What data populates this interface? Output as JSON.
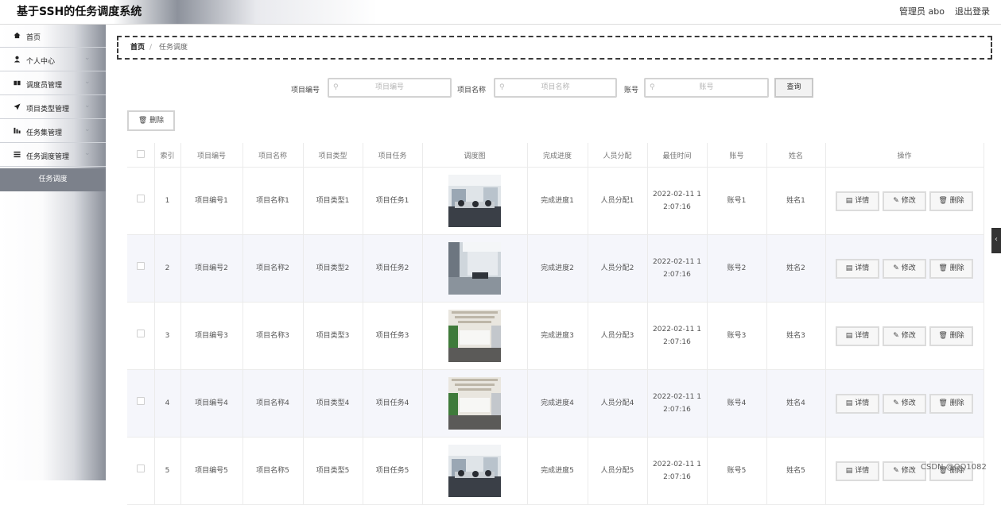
{
  "header": {
    "app_title": "基于SSH的任务调度系统",
    "user": "管理员 abo",
    "logout": "退出登录"
  },
  "sidebar": {
    "items": [
      {
        "label": "首页",
        "icon": "home-icon"
      },
      {
        "label": "个人中心",
        "icon": "user-icon"
      },
      {
        "label": "调度员管理",
        "icon": "users-icon"
      },
      {
        "label": "项目类型管理",
        "icon": "send-icon"
      },
      {
        "label": "任务集管理",
        "icon": "chart-icon"
      },
      {
        "label": "任务调度管理",
        "icon": "list-icon"
      }
    ],
    "active_sub": "任务调度"
  },
  "breadcrumb": {
    "home": "首页",
    "separator": "/",
    "current": "任务调度"
  },
  "search": {
    "fields": [
      {
        "label": "项目编号",
        "placeholder": "项目编号"
      },
      {
        "label": "项目名称",
        "placeholder": "项目名称"
      },
      {
        "label": "账号",
        "placeholder": "账号"
      }
    ],
    "button": "查询"
  },
  "toolbar": {
    "delete_label": "删除"
  },
  "table": {
    "headers": [
      "索引",
      "项目编号",
      "项目名称",
      "项目类型",
      "项目任务",
      "调度图",
      "完成进度",
      "人员分配",
      "最佳时间",
      "账号",
      "姓名",
      "操作"
    ],
    "rows": [
      {
        "index": "1",
        "code": "项目编号1",
        "name": "项目名称1",
        "type": "项目类型1",
        "task": "项目任务1",
        "progress": "完成进度1",
        "assign": "人员分配1",
        "time_a": "2022-02-11 1",
        "time_b": "2:07:16",
        "account": "账号1",
        "person": "姓名1"
      },
      {
        "index": "2",
        "code": "项目编号2",
        "name": "项目名称2",
        "type": "项目类型2",
        "task": "项目任务2",
        "progress": "完成进度2",
        "assign": "人员分配2",
        "time_a": "2022-02-11 1",
        "time_b": "2:07:16",
        "account": "账号2",
        "person": "姓名2"
      },
      {
        "index": "3",
        "code": "项目编号3",
        "name": "项目名称3",
        "type": "项目类型3",
        "task": "项目任务3",
        "progress": "完成进度3",
        "assign": "人员分配3",
        "time_a": "2022-02-11 1",
        "time_b": "2:07:16",
        "account": "账号3",
        "person": "姓名3"
      },
      {
        "index": "4",
        "code": "项目编号4",
        "name": "项目名称4",
        "type": "项目类型4",
        "task": "项目任务4",
        "progress": "完成进度4",
        "assign": "人员分配4",
        "time_a": "2022-02-11 1",
        "time_b": "2:07:16",
        "account": "账号4",
        "person": "姓名4"
      },
      {
        "index": "5",
        "code": "项目编号5",
        "name": "项目名称5",
        "type": "项目类型5",
        "task": "项目任务5",
        "progress": "完成进度5",
        "assign": "人员分配5",
        "time_a": "2022-02-11 1",
        "time_b": "2:07:16",
        "account": "账号5",
        "person": "姓名5"
      }
    ],
    "actions": {
      "detail": "详情",
      "edit": "修改",
      "delete": "删除"
    }
  },
  "watermark": "CSDN @QQ1082"
}
